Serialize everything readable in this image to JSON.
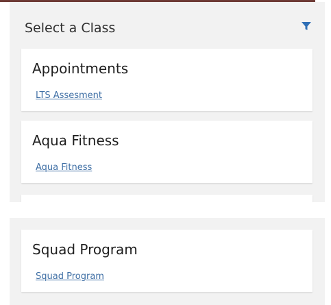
{
  "header": {
    "title": "Select a Class",
    "filter_icon": "filter-icon",
    "accent_color": "#3f6fa5"
  },
  "classes": [
    {
      "title": "Appointments",
      "link": "LTS Assesment"
    },
    {
      "title": "Aqua Fitness",
      "link": "Aqua Fitness"
    },
    {
      "title": "Squad Program",
      "link": "Squad Program"
    }
  ]
}
